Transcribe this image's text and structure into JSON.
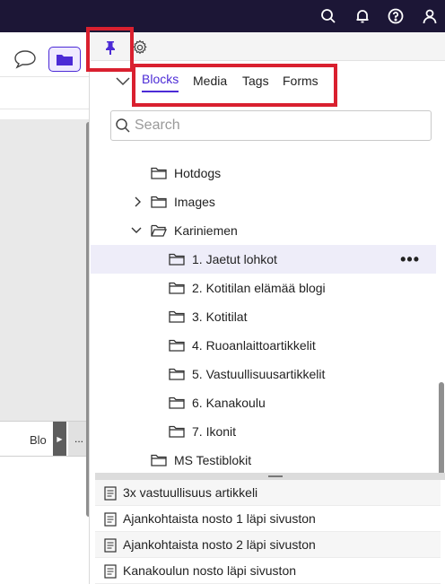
{
  "topbar": {
    "icons": [
      "search-icon",
      "bell-icon",
      "help-icon",
      "user-icon"
    ]
  },
  "editor": {
    "bottom_label": "Blo",
    "more_label": "..."
  },
  "panel": {
    "tabs": [
      {
        "label": "Blocks",
        "active": true
      },
      {
        "label": "Media",
        "active": false
      },
      {
        "label": "Tags",
        "active": false
      },
      {
        "label": "Forms",
        "active": false
      }
    ],
    "search_placeholder": "Search",
    "tree": [
      {
        "label": "Hotdogs",
        "level": 0,
        "expander": "none"
      },
      {
        "label": "Images",
        "level": 0,
        "expander": "collapsed"
      },
      {
        "label": "Kariniemen",
        "level": 0,
        "expander": "expanded"
      },
      {
        "label": "1. Jaetut lohkot",
        "level": 1,
        "selected": true,
        "more": "•••"
      },
      {
        "label": "2. Kotitilan elämää blogi",
        "level": 1
      },
      {
        "label": "3. Kotitilat",
        "level": 1
      },
      {
        "label": "4. Ruoanlaittoartikkelit",
        "level": 1
      },
      {
        "label": "5. Vastuullisuusartikkelit",
        "level": 1
      },
      {
        "label": "6. Kanakoulu",
        "level": 1
      },
      {
        "label": "7. Ikonit",
        "level": 1
      },
      {
        "label": "MS Testiblokit",
        "level": 0,
        "expander": "none"
      }
    ],
    "items": [
      "3x vastuullisuus artikkeli",
      "Ajankohtaista nosto 1 läpi sivuston",
      "Ajankohtaista nosto 2 läpi sivuston",
      "Kanakoulun nosto läpi sivuston"
    ]
  },
  "colors": {
    "topbar": "#1c1636",
    "accent": "#4c2bd6",
    "highlight": "#d9202f",
    "selected_row": "#eeedf9"
  }
}
